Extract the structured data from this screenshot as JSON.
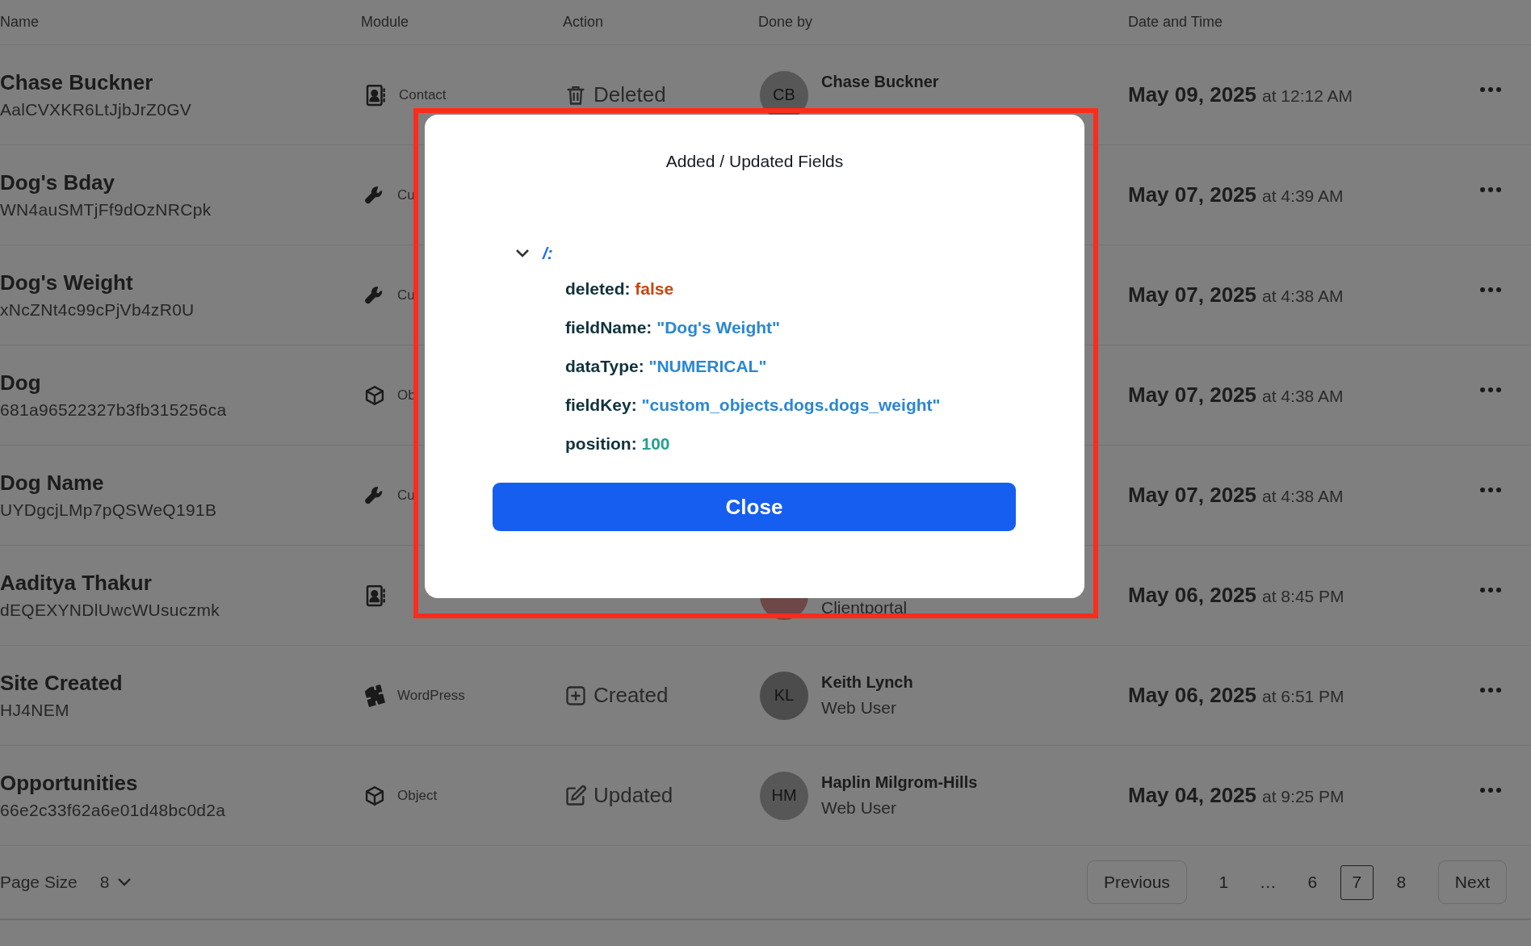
{
  "columns": [
    "Name",
    "Module",
    "Action",
    "Done by",
    "Date and Time"
  ],
  "rows": [
    {
      "name": "Chase Buckner",
      "record_id": "AalCVXKR6LtJjbJrZ0GV",
      "module": {
        "kind": "contact",
        "label": "Contact"
      },
      "action": {
        "kind": "deleted",
        "label": "Deleted"
      },
      "done_by": {
        "initials": "CB",
        "color": "#575757",
        "name": "Chase Buckner"
      },
      "date": "May 09, 2025",
      "time": "at 12:12 AM"
    },
    {
      "name": "Dog's Bday",
      "record_id": "WN4auSMTjFf9dOzNRCpk",
      "module": {
        "kind": "custom",
        "label": "Cu"
      },
      "date": "May 07, 2025",
      "time": "at 4:39 AM"
    },
    {
      "name": "Dog's Weight",
      "record_id": "xNcZNt4c99cPjVb4zR0U",
      "module": {
        "kind": "custom",
        "label": "Cu"
      },
      "date": "May 07, 2025",
      "time": "at 4:38 AM"
    },
    {
      "name": "Dog",
      "record_id": "681a96522327b3fb315256ca",
      "module": {
        "kind": "object",
        "label": "Ob"
      },
      "date": "May 07, 2025",
      "time": "at 4:38 AM"
    },
    {
      "name": "Dog Name",
      "record_id": "UYDgcjLMp7pQSWeQ191B",
      "module": {
        "kind": "custom",
        "label": "Cu"
      },
      "date": "May 07, 2025",
      "time": "at 4:38 AM"
    },
    {
      "name": "Aaditya Thakur",
      "record_id": "dEQEXYNDlUwcWUsuczmk",
      "module": {
        "kind": "contact"
      },
      "done_by": {
        "color": "#6e4747",
        "source": "Clientportal"
      },
      "date": "May 06, 2025",
      "time": "at 8:45 PM"
    },
    {
      "name": "Site Created",
      "record_id": "HJ4NEM",
      "module": {
        "kind": "plugin",
        "label": "WordPress"
      },
      "action": {
        "kind": "created",
        "label": "Created"
      },
      "done_by": {
        "initials": "KL",
        "color": "#4c4c4c",
        "name": "Keith Lynch",
        "source": "Web User"
      },
      "date": "May 06, 2025",
      "time": "at 6:51 PM"
    },
    {
      "name": "Opportunities",
      "record_id": "66e2c33f62a6e01d48bc0d2a",
      "module": {
        "kind": "object",
        "label": "Object"
      },
      "action": {
        "kind": "updated",
        "label": "Updated"
      },
      "done_by": {
        "initials": "HM",
        "color": "#575757",
        "name": "Haplin Milgrom-Hills",
        "source": "Web User"
      },
      "date": "May 04, 2025",
      "time": "at 9:25 PM"
    }
  ],
  "pagination": {
    "page_size_label": "Page Size",
    "page_size": "8",
    "previous": "Previous",
    "pages": [
      {
        "label": "1",
        "selected": false
      },
      {
        "label": "…",
        "selected": false
      },
      {
        "label": "6",
        "selected": false
      },
      {
        "label": "7",
        "selected": true
      },
      {
        "label": "8",
        "selected": false
      }
    ],
    "next": "Next"
  },
  "dialog": {
    "title": "Added / Updated Fields",
    "tree": {
      "label": "/:",
      "expanded": true,
      "children": [
        {
          "key": "deleted:",
          "value": "false",
          "kind": "boolean"
        },
        {
          "key": "fieldName:",
          "value": "\"Dog's Weight\"",
          "kind": "string"
        },
        {
          "key": "dataType:",
          "value": "\"NUMERICAL\"",
          "kind": "string"
        },
        {
          "key": "fieldKey:",
          "value": "\"custom_objects.dogs.dogs_weight\"",
          "kind": "string"
        },
        {
          "key": "position:",
          "value": "100",
          "kind": "number"
        }
      ]
    },
    "close_button": "Close"
  }
}
